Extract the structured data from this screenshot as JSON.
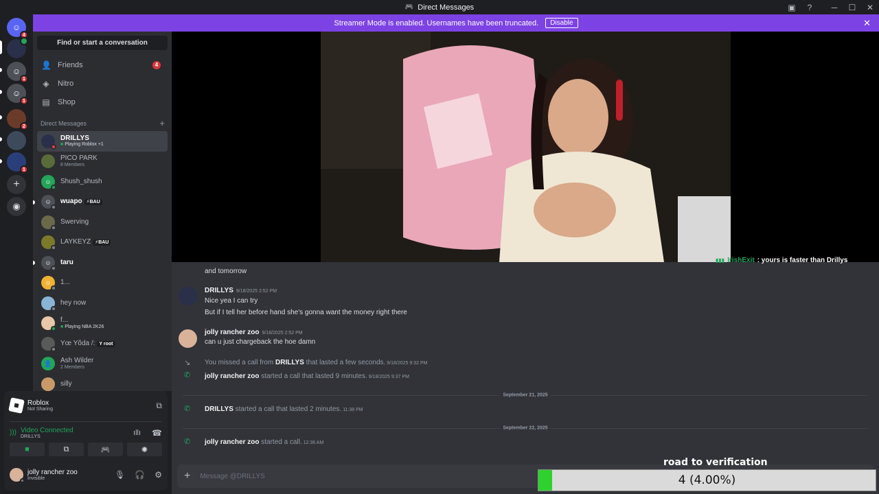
{
  "window": {
    "title": "Direct Messages"
  },
  "banner": {
    "text": "Streamer Mode is enabled. Usernames have been truncated.",
    "disable_label": "Disable"
  },
  "guilds": [
    {
      "badge": "4",
      "color": "#5865f2"
    },
    {
      "badge": "",
      "color": "#2a2f4a"
    },
    {
      "badge": "1",
      "color": "#4e5058"
    },
    {
      "badge": "1",
      "color": "#4e5058"
    },
    {
      "badge": "2",
      "color": "#6b3b2a"
    },
    {
      "badge": "",
      "color": "#3d4a5c"
    },
    {
      "badge": "1",
      "color": "#2a3f7a"
    }
  ],
  "sidebar": {
    "search_label": "Find or start a conversation",
    "nav": [
      {
        "label": "Friends",
        "badge": "4"
      },
      {
        "label": "Nitro"
      },
      {
        "label": "Shop"
      }
    ],
    "dm_header": "Direct Messages",
    "dm_add": "+",
    "dms": [
      {
        "name": "DRILLYS",
        "sub": "Playing Roblox +1",
        "color": "#2a2f4a"
      },
      {
        "name": "PICO PARK",
        "sub": "8 Members",
        "color": "#5a6b3a"
      },
      {
        "name": "Shush_shush",
        "sub": "",
        "color": "#23a55a"
      },
      {
        "name": "wuapo",
        "sub": "",
        "tag": "⚡BAU",
        "color": "#4e5058"
      },
      {
        "name": "Swerving",
        "sub": "",
        "color": "#6a6a4a"
      },
      {
        "name": "LAYKEYZ",
        "sub": "",
        "tag": "⚡BAU",
        "color": "#7a7a2a"
      },
      {
        "name": "taru",
        "sub": "",
        "color": "#4e5058"
      },
      {
        "name": "1...",
        "sub": "",
        "color": "#f0b232"
      },
      {
        "name": "hey now",
        "sub": "",
        "color": "#8ab4d4"
      },
      {
        "name": "f...",
        "sub": "Playing NBA 2K26",
        "color": "#e8c8a8"
      },
      {
        "name": "Yœ Yõda /:",
        "sub": "",
        "tag": "Y root",
        "color": "#5a5a5a"
      },
      {
        "name": "Ash Wilder",
        "sub": "2 Members",
        "color": "#23a55a"
      },
      {
        "name": "silly",
        "sub": "",
        "color": "#c89a6a"
      }
    ]
  },
  "panel": {
    "activity_title": "Roblox",
    "activity_sub": "Not Sharing",
    "voice_status": "Video Connected",
    "voice_channel": "DRILLYS",
    "user_name": "jolly rancher zoo",
    "user_status": "Invisible"
  },
  "stream_chat": {
    "user": "IrishExit",
    "text": ": yours is faster than Drillys"
  },
  "messages": {
    "cut_line": "and tomorrow",
    "m1": {
      "user": "DRILLYS",
      "time": "9/18/2025 2:52 PM",
      "line1": "Nice yea I can try",
      "line2": "But if I tell her before hand she's gonna want the money right there"
    },
    "m2": {
      "user": "jolly rancher zoo",
      "time": "9/18/2025 2:52 PM",
      "line1": "can u just chargeback the hoe damn"
    },
    "s1": {
      "pre": "You missed a call from ",
      "user": "DRILLYS",
      "post": " that lasted a few seconds.",
      "time": "9/18/2025 9:32 PM"
    },
    "s2": {
      "user": "jolly rancher zoo",
      "post": " started a call that lasted 9 minutes.",
      "time": "9/18/2025 9:37 PM"
    },
    "d1": "September 21, 2025",
    "s3": {
      "user": "DRILLYS",
      "post": " started a call that lasted 2 minutes.",
      "time": "11:38 PM"
    },
    "d2": "September 22, 2025",
    "s4": {
      "user": "jolly rancher zoo",
      "post": " started a call.",
      "time": "12:36 AM"
    }
  },
  "composer": {
    "placeholder": "Message @DRILLYS"
  },
  "verification": {
    "label": "road to verification",
    "text": "4 (4.00%)",
    "progress": 0.04
  }
}
